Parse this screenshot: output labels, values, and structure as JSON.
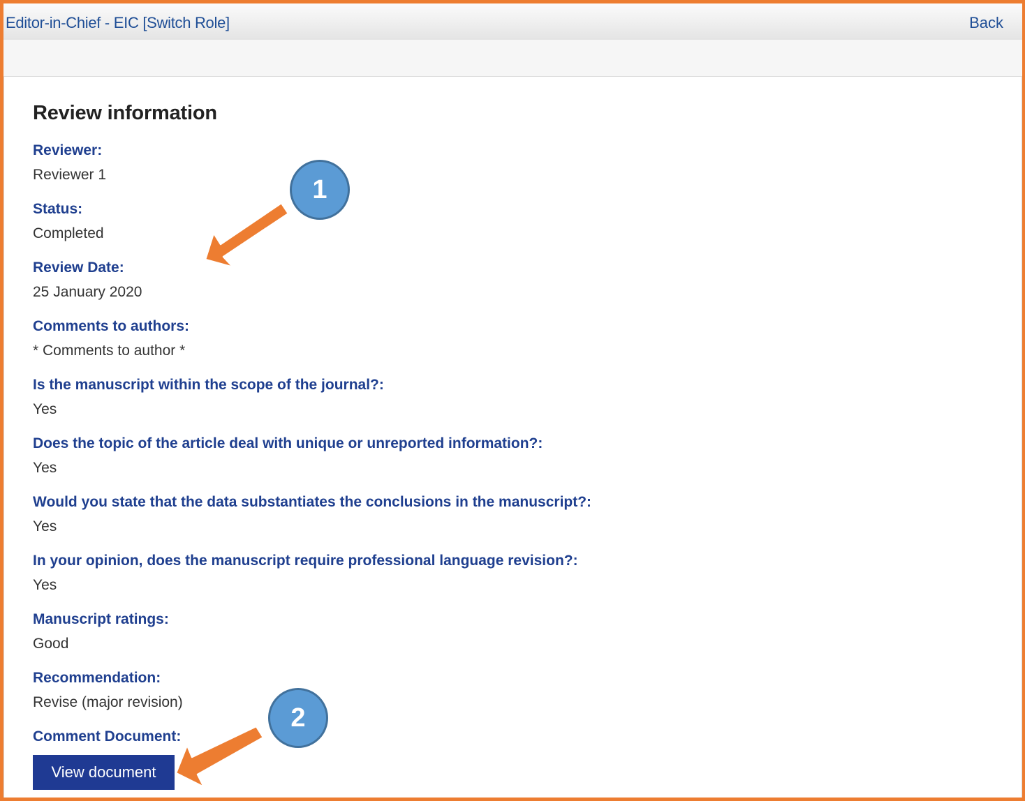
{
  "header": {
    "role_text": "Editor-in-Chief - EIC [Switch Role]",
    "back_label": "Back"
  },
  "review": {
    "title": "Review information",
    "fields": [
      {
        "label": "Reviewer:",
        "value": "Reviewer 1"
      },
      {
        "label": "Status:",
        "value": "Completed"
      },
      {
        "label": "Review Date:",
        "value": "25 January 2020"
      },
      {
        "label": "Comments to authors:",
        "value": "* Comments to author *"
      },
      {
        "label": "Is the manuscript within the scope of the journal?:",
        "value": "Yes"
      },
      {
        "label": "Does the topic of the article deal with unique or unreported information?:",
        "value": "Yes"
      },
      {
        "label": "Would you state that the data substantiates the conclusions in the manuscript?:",
        "value": "Yes"
      },
      {
        "label": "In your opinion, does the manuscript require professional language revision?:",
        "value": "Yes"
      },
      {
        "label": "Manuscript ratings:",
        "value": "Good"
      },
      {
        "label": "Recommendation:",
        "value": "Revise (major revision)"
      },
      {
        "label": "Comment Document:"
      }
    ],
    "view_button_label": "View document"
  },
  "annotations": {
    "badge_1": "1",
    "badge_2": "2",
    "accent_color": "#ED7D31",
    "badge_color": "#5B9BD5",
    "link_color": "#1F4E96",
    "button_color": "#1F3A93"
  }
}
